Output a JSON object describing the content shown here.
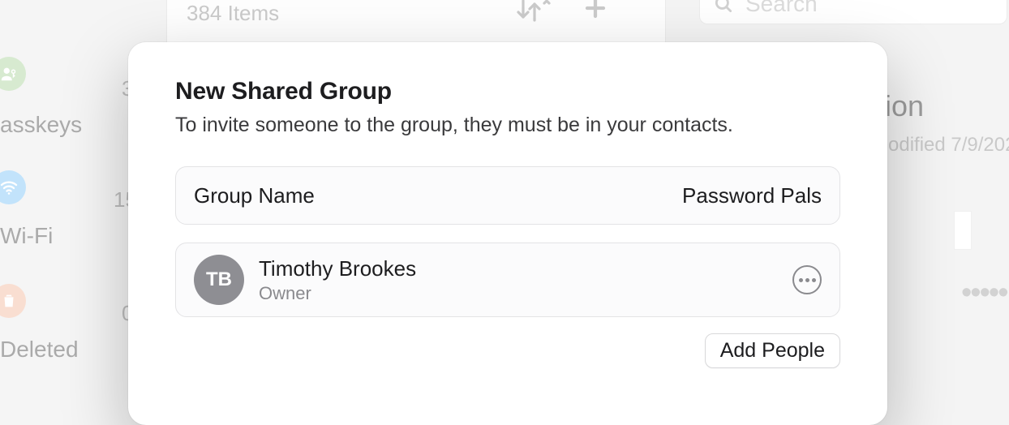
{
  "background": {
    "sidebar": {
      "items": [
        {
          "label": "asskeys",
          "count": "3"
        },
        {
          "label": "Wi-Fi",
          "count": "15"
        },
        {
          "label": "Deleted",
          "count": "0"
        }
      ]
    },
    "list": {
      "items_count": "384 Items"
    },
    "search": {
      "placeholder": "Search"
    },
    "detail": {
      "title_fragment": "ision",
      "modified_fragment": "odified 7/9/202"
    }
  },
  "dialog": {
    "title": "New Shared Group",
    "subtitle": "To invite someone to the group, they must be in your contacts.",
    "group_name_label": "Group Name",
    "group_name_value": "Password Pals",
    "members": [
      {
        "initials": "TB",
        "name": "Timothy Brookes",
        "role": "Owner"
      }
    ],
    "add_people_label": "Add People"
  }
}
